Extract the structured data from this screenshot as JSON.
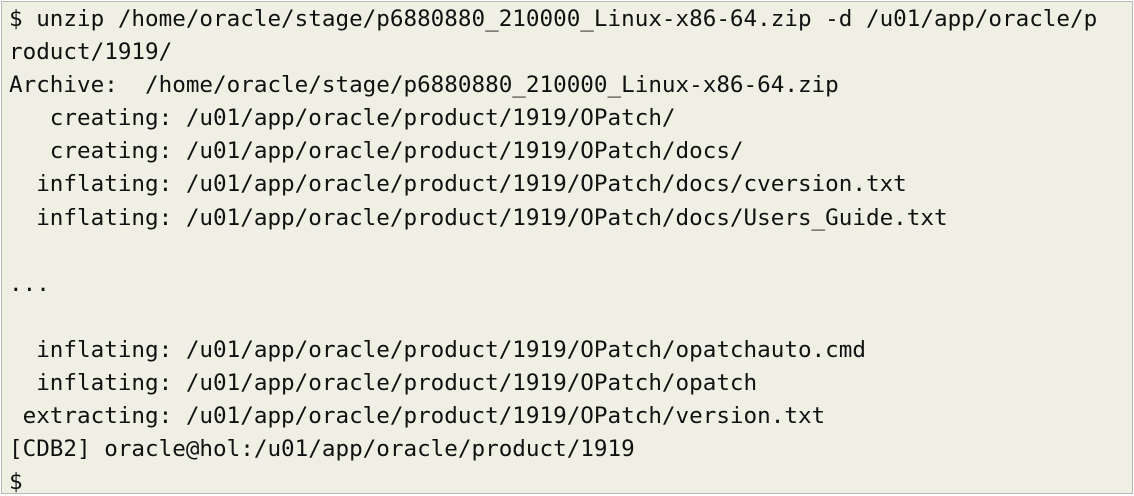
{
  "terminal": {
    "lines": [
      "$ unzip /home/oracle/stage/p6880880_210000_Linux-x86-64.zip -d /u01/app/oracle/p",
      "roduct/1919/",
      "Archive:  /home/oracle/stage/p6880880_210000_Linux-x86-64.zip",
      "   creating: /u01/app/oracle/product/1919/OPatch/",
      "   creating: /u01/app/oracle/product/1919/OPatch/docs/",
      "  inflating: /u01/app/oracle/product/1919/OPatch/docs/cversion.txt",
      "  inflating: /u01/app/oracle/product/1919/OPatch/docs/Users_Guide.txt",
      "",
      "...",
      "",
      "  inflating: /u01/app/oracle/product/1919/OPatch/opatchauto.cmd",
      "  inflating: /u01/app/oracle/product/1919/OPatch/opatch",
      " extracting: /u01/app/oracle/product/1919/OPatch/version.txt",
      "[CDB2] oracle@hol:/u01/app/oracle/product/1919",
      "$"
    ]
  },
  "colors": {
    "background": "#eff0e3",
    "text": "#111111",
    "border": "#b8b8b8"
  }
}
